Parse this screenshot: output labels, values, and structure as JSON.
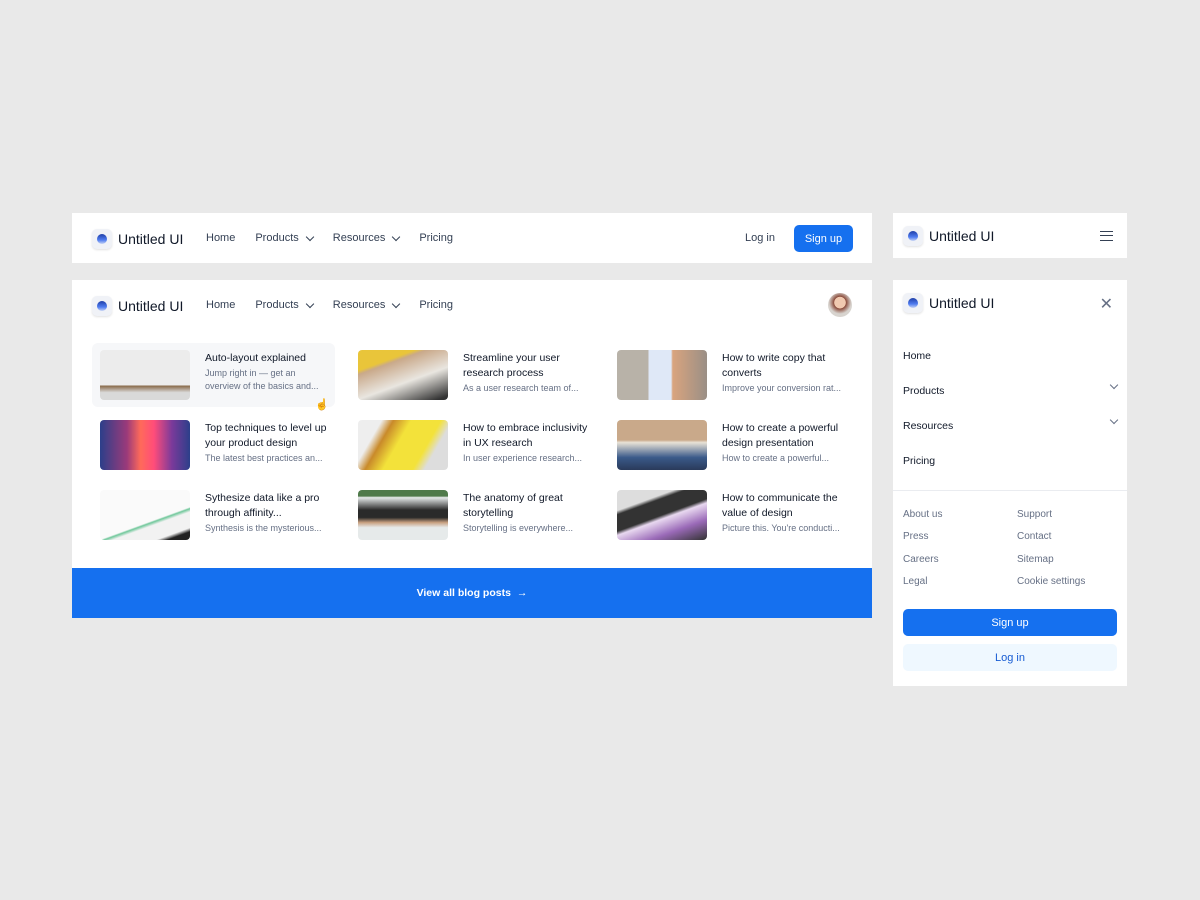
{
  "brand": "Untitled UI",
  "nav": {
    "home": "Home",
    "products": "Products",
    "resources": "Resources",
    "pricing": "Pricing"
  },
  "header": {
    "login": "Log in",
    "signup": "Sign up"
  },
  "accent": "#1570ef",
  "posts": [
    {
      "title": "Auto-layout explained",
      "desc": "Jump right in — get an overview of the basics and..."
    },
    {
      "title": "Streamline your user research process",
      "desc": "As a user research team of..."
    },
    {
      "title": "How to write copy that converts",
      "desc": "Improve your conversion rat..."
    },
    {
      "title": "Top techniques to level up your product design",
      "desc": "The latest best practices an..."
    },
    {
      "title": "How to embrace inclusivity in UX research",
      "desc": "In user experience research..."
    },
    {
      "title": "How to create a powerful design presentation",
      "desc": "How to create a powerful..."
    },
    {
      "title": "Sythesize data like a pro through affinity...",
      "desc": "Synthesis is the mysterious..."
    },
    {
      "title": "The anatomy of great storytelling",
      "desc": "Storytelling is everywhere..."
    },
    {
      "title": "How to communicate the value of design",
      "desc": "Picture this. You're conducti..."
    }
  ],
  "view_all": "View all blog posts",
  "mobile": {
    "footer_links": [
      "About us",
      "Support",
      "Press",
      "Contact",
      "Careers",
      "Sitemap",
      "Legal",
      "Cookie settings"
    ],
    "signup": "Sign up",
    "login": "Log in"
  }
}
